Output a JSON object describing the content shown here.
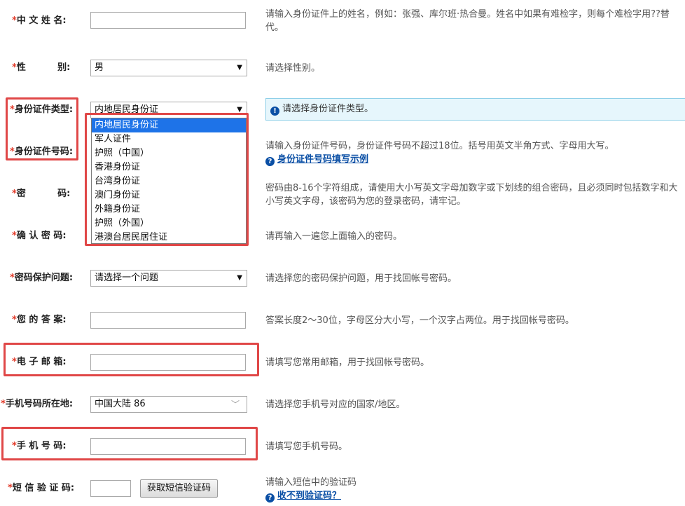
{
  "star": "*",
  "fields": {
    "name": {
      "label": "中 文 姓 名:",
      "hint": "请输入身份证件上的姓名，例如：张强、库尔班·热合曼。姓名中如果有难检字，则每个难检字用??替代。"
    },
    "gender": {
      "label": "性          别:",
      "value": "男",
      "hint": "请选择性别。"
    },
    "id_type": {
      "label": "身份证件类型:",
      "value": "内地居民身份证",
      "tip": "请选择身份证件类型。",
      "options": [
        "内地居民身份证",
        "军人证件",
        "护照（中国）",
        "香港身份证",
        "台湾身份证",
        "澳门身份证",
        "外籍身份证",
        "护照（外国）",
        "港澳台居民居住证"
      ]
    },
    "id_number": {
      "label": "身份证件号码:",
      "hint": "请输入身份证件号码，身份证件号码不超过18位。括号用英文半角方式、字母用大写。",
      "link": "身份证件号码填写示例"
    },
    "password": {
      "label": "密          码:",
      "hint": "密码由8-16个字符组成，请使用大小写英文字母加数字或下划线的组合密码，且必须同时包括数字和大小写英文字母，该密码为您的登录密码，请牢记。"
    },
    "confirm_password": {
      "label": "确 认 密 码:",
      "hint": "请再输入一遍您上面输入的密码。"
    },
    "security_question": {
      "label": "密码保护问题:",
      "value": "请选择一个问题",
      "hint": "请选择您的密码保护问题，用于找回帐号密码。"
    },
    "answer": {
      "label": "您 的 答 案:",
      "hint": "答案长度2～30位，字母区分大小写，一个汉字占两位。用于找回帐号密码。"
    },
    "email": {
      "label": "电 子 邮 箱:",
      "hint": "请填写您常用邮箱，用于找回帐号密码。"
    },
    "phone_region": {
      "label": "手机号码所在地:",
      "value": "中国大陆 86",
      "hint": "请选择您手机号对应的国家/地区。"
    },
    "phone": {
      "label": "手 机 号 码:",
      "hint": "请填写您手机号码。"
    },
    "sms_code": {
      "label": "短 信 验 证 码:",
      "button": "获取短信验证码",
      "hint": "请输入短信中的验证码",
      "link": "收不到验证码？"
    }
  },
  "colors": {
    "required_star": "#e23b2a",
    "highlight_box": "#e04747",
    "link": "#0a4fa5",
    "selected_option": "#1e73e8",
    "tip_bg": "#e6f6fc"
  }
}
